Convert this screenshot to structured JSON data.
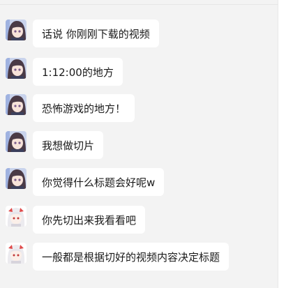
{
  "messages": [
    {
      "sender": "a",
      "text": "话说 你刚刚下载的视频"
    },
    {
      "sender": "a",
      "text": "1:12:00的地方"
    },
    {
      "sender": "a",
      "text": "恐怖游戏的地方！"
    },
    {
      "sender": "a",
      "text": "我想做切片"
    },
    {
      "sender": "a",
      "text": "你觉得什么标题会好呢w"
    },
    {
      "sender": "b",
      "text": "你先切出来我看看吧"
    },
    {
      "sender": "b",
      "text": "一般都是根据切好的视频内容决定标题"
    }
  ],
  "colors": {
    "panel_bg": "#f3f3f3",
    "bubble_bg": "#ffffff",
    "text": "#1a1a1a"
  }
}
